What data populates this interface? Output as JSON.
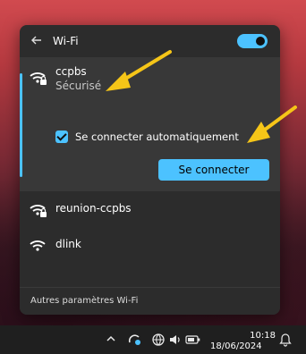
{
  "panel": {
    "title": "Wi-Fi",
    "toggle_on": true,
    "footer_label": "Autres paramètres Wi-Fi"
  },
  "networks": [
    {
      "name": "ccpbs",
      "status": "Sécurisé",
      "secured": true,
      "active": true
    },
    {
      "name": "reunion-ccpbs",
      "secured": true,
      "active": false
    },
    {
      "name": "dlink",
      "secured": false,
      "active": false
    }
  ],
  "auto_connect": {
    "label": "Se connecter automatiquement",
    "checked": true
  },
  "connect_button": {
    "label": "Se connecter"
  },
  "taskbar": {
    "time": "10:18",
    "date": "18/06/2024"
  },
  "colors": {
    "accent": "#4cc2ff",
    "panel_bg": "#2c2c2c",
    "arrow": "#f5c518"
  }
}
